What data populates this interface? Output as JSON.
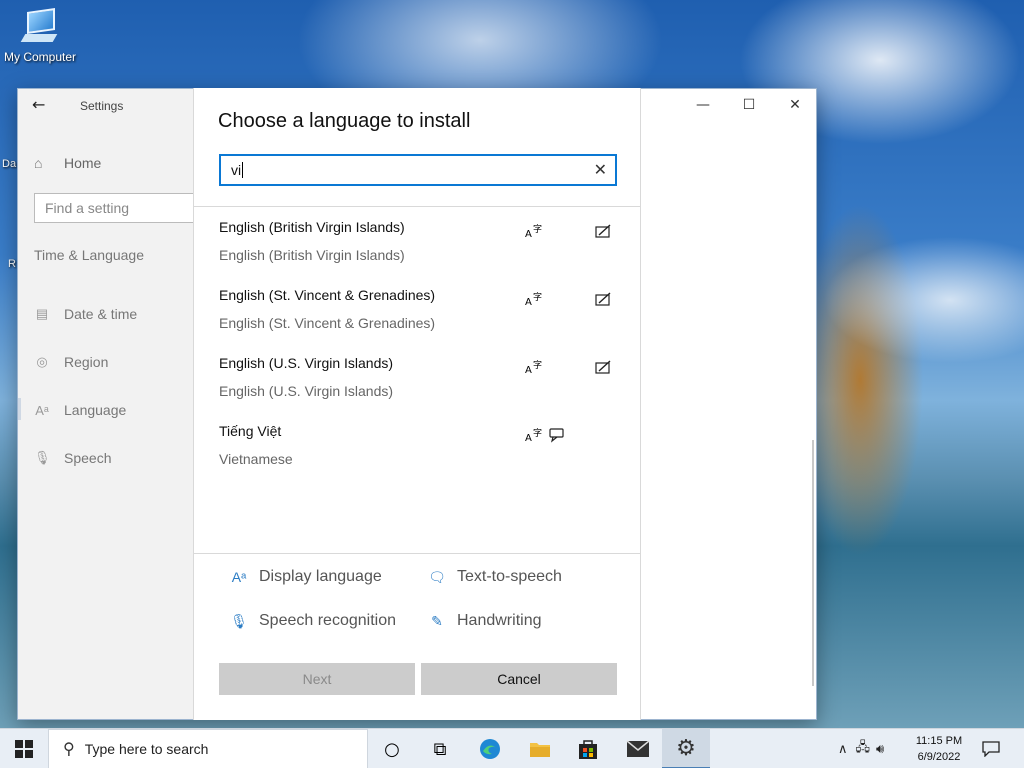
{
  "desktop": {
    "icon_label": "My Computer",
    "fragments": [
      "Da",
      "R"
    ]
  },
  "settings": {
    "title": "Settings",
    "back_icon": "back-arrow-icon",
    "home": "Home",
    "find_placeholder": "Find a setting",
    "section": "Time & Language",
    "nav": [
      {
        "label": "Date & time",
        "icon": "calendar-clock-icon"
      },
      {
        "label": "Region",
        "icon": "globe-icon"
      },
      {
        "label": "Language",
        "icon": "language-icon"
      },
      {
        "label": "Speech",
        "icon": "microphone-icon"
      }
    ],
    "window_controls": [
      "minimize",
      "maximize",
      "close"
    ]
  },
  "dialog": {
    "title": "Choose a language to install",
    "search_value": "vi",
    "languages": [
      {
        "name": "English (British Virgin Islands)",
        "native": "English (British Virgin Islands)",
        "features": [
          "display-language",
          "handwriting"
        ]
      },
      {
        "name": "English (St. Vincent & Grenadines)",
        "native": "English (St. Vincent & Grenadines)",
        "features": [
          "display-language",
          "handwriting"
        ]
      },
      {
        "name": "English (U.S. Virgin Islands)",
        "native": "English (U.S. Virgin Islands)",
        "features": [
          "display-language",
          "handwriting"
        ]
      },
      {
        "name": "Tiếng Việt",
        "native": "Vietnamese",
        "features": [
          "display-language",
          "text-to-speech"
        ]
      }
    ],
    "legend": {
      "display_language": "Display language",
      "text_to_speech": "Text-to-speech",
      "speech_recognition": "Speech recognition",
      "handwriting": "Handwriting"
    },
    "buttons": {
      "next": "Next",
      "cancel": "Cancel"
    }
  },
  "taskbar": {
    "search_placeholder": "Type here to search",
    "apps": [
      "cortana-circle",
      "task-view",
      "edge",
      "file-explorer",
      "store",
      "mail",
      "settings"
    ],
    "time": "11:15 PM",
    "date": "6/9/2022"
  },
  "colors": {
    "accent": "#0a78d4",
    "button": "#cccccc",
    "sidebar": "#f2f2f2"
  }
}
